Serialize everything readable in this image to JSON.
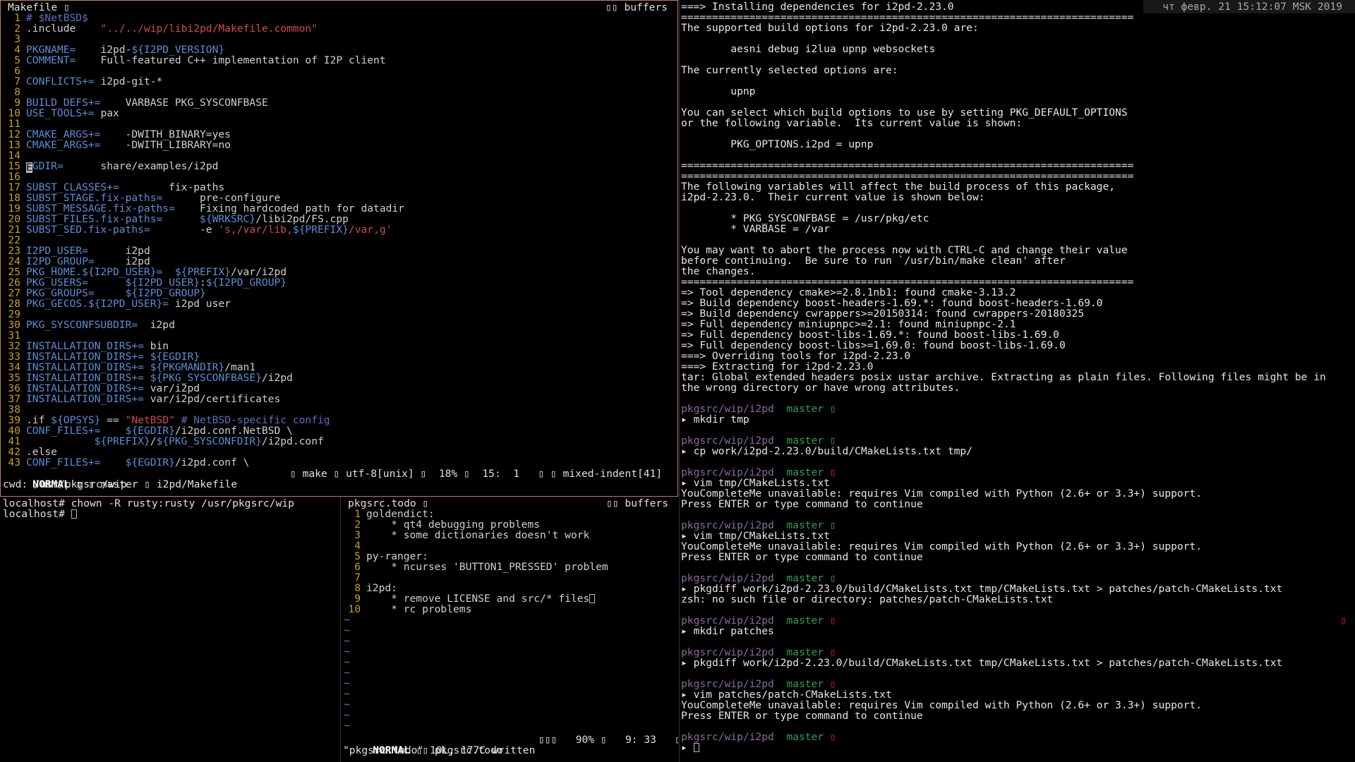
{
  "makefile": {
    "title": "Makefile ▯",
    "buffers_label": "▯▯ buffers",
    "lines": [
      {
        "n": "1",
        "parts": [
          [
            "c",
            "# $NetBSD$"
          ]
        ]
      },
      {
        "n": "2",
        "parts": [
          [
            "plain",
            ".include    "
          ],
          [
            "s",
            "\"../../wip/libi2pd/Makefile.common\""
          ]
        ]
      },
      {
        "n": "3",
        "parts": []
      },
      {
        "n": "4",
        "parts": [
          [
            "v",
            "PKGNAME="
          ],
          [
            "plain",
            "    i2pd-"
          ],
          [
            "v",
            "${I2PD_VERSION}"
          ]
        ]
      },
      {
        "n": "5",
        "parts": [
          [
            "v",
            "COMMENT="
          ],
          [
            "plain",
            "    Full-featured C++ implementation of I2P client"
          ]
        ]
      },
      {
        "n": "6",
        "parts": []
      },
      {
        "n": "7",
        "parts": [
          [
            "v",
            "CONFLICTS+="
          ],
          [
            "plain",
            " i2pd-git-*"
          ]
        ]
      },
      {
        "n": "8",
        "parts": []
      },
      {
        "n": "9",
        "parts": [
          [
            "v",
            "BUILD_DEFS+="
          ],
          [
            "plain",
            "    VARBASE PKG_SYSCONFBASE"
          ]
        ]
      },
      {
        "n": "10",
        "parts": [
          [
            "v",
            "USE_TOOLS+="
          ],
          [
            "plain",
            " pax"
          ]
        ]
      },
      {
        "n": "11",
        "parts": []
      },
      {
        "n": "12",
        "parts": [
          [
            "v",
            "CMAKE_ARGS+="
          ],
          [
            "plain",
            "    -DWITH_BINARY=yes"
          ]
        ]
      },
      {
        "n": "13",
        "parts": [
          [
            "v",
            "CMAKE_ARGS+="
          ],
          [
            "plain",
            "    -DWITH_LIBRARY=no"
          ]
        ]
      },
      {
        "n": "14",
        "parts": []
      },
      {
        "n": "15",
        "parts": [
          [
            "cursor",
            "E"
          ],
          [
            "v",
            "GDIR="
          ],
          [
            "plain",
            "      share/examples/i2pd"
          ]
        ]
      },
      {
        "n": "16",
        "parts": []
      },
      {
        "n": "17",
        "parts": [
          [
            "v",
            "SUBST_CLASSES+="
          ],
          [
            "plain",
            "        fix-paths"
          ]
        ]
      },
      {
        "n": "18",
        "parts": [
          [
            "v",
            "SUBST_STAGE.fix-paths="
          ],
          [
            "plain",
            "      pre-configure"
          ]
        ]
      },
      {
        "n": "19",
        "parts": [
          [
            "v",
            "SUBST_MESSAGE.fix-paths="
          ],
          [
            "plain",
            "    Fixing hardcoded path for datadir"
          ]
        ]
      },
      {
        "n": "20",
        "parts": [
          [
            "v",
            "SUBST_FILES.fix-paths="
          ],
          [
            "plain",
            "      "
          ],
          [
            "v",
            "${WRKSRC}"
          ],
          [
            "plain",
            "/libi2pd/FS.cpp"
          ]
        ]
      },
      {
        "n": "21",
        "parts": [
          [
            "v",
            "SUBST_SED.fix-paths="
          ],
          [
            "plain",
            "        -e "
          ],
          [
            "s",
            "'s,/var/lib,"
          ],
          [
            "v",
            "${PREFIX}"
          ],
          [
            "s",
            "/var,g'"
          ]
        ]
      },
      {
        "n": "22",
        "parts": []
      },
      {
        "n": "23",
        "parts": [
          [
            "v",
            "I2PD_USER="
          ],
          [
            "plain",
            "      i2pd"
          ]
        ]
      },
      {
        "n": "24",
        "parts": [
          [
            "v",
            "I2PD_GROUP="
          ],
          [
            "plain",
            "     i2pd"
          ]
        ]
      },
      {
        "n": "25",
        "parts": [
          [
            "v",
            "PKG_HOME.${I2PD_USER}="
          ],
          [
            "plain",
            "  "
          ],
          [
            "v",
            "${PREFIX}"
          ],
          [
            "plain",
            "/var/i2pd"
          ]
        ]
      },
      {
        "n": "26",
        "parts": [
          [
            "v",
            "PKG_USERS="
          ],
          [
            "plain",
            "      "
          ],
          [
            "v",
            "${I2PD_USER}"
          ],
          [
            "plain",
            ":"
          ],
          [
            "v",
            "${I2PD_GROUP}"
          ]
        ]
      },
      {
        "n": "27",
        "parts": [
          [
            "v",
            "PKG_GROUPS="
          ],
          [
            "plain",
            "     "
          ],
          [
            "v",
            "${I2PD_GROUP}"
          ]
        ]
      },
      {
        "n": "28",
        "parts": [
          [
            "v",
            "PKG_GECOS.${I2PD_USER}="
          ],
          [
            "plain",
            " i2pd user"
          ]
        ]
      },
      {
        "n": "29",
        "parts": []
      },
      {
        "n": "30",
        "parts": [
          [
            "v",
            "PKG_SYSCONFSUBDIR="
          ],
          [
            "plain",
            "  i2pd"
          ]
        ]
      },
      {
        "n": "31",
        "parts": []
      },
      {
        "n": "32",
        "parts": [
          [
            "v",
            "INSTALLATION_DIRS+="
          ],
          [
            "plain",
            " bin"
          ]
        ]
      },
      {
        "n": "33",
        "parts": [
          [
            "v",
            "INSTALLATION_DIRS+="
          ],
          [
            "plain",
            " "
          ],
          [
            "v",
            "${EGDIR}"
          ]
        ]
      },
      {
        "n": "34",
        "parts": [
          [
            "v",
            "INSTALLATION_DIRS+="
          ],
          [
            "plain",
            " "
          ],
          [
            "v",
            "${PKGMANDIR}"
          ],
          [
            "plain",
            "/man1"
          ]
        ]
      },
      {
        "n": "35",
        "parts": [
          [
            "v",
            "INSTALLATION_DIRS+="
          ],
          [
            "plain",
            " "
          ],
          [
            "v",
            "${PKG_SYSCONFBASE}"
          ],
          [
            "plain",
            "/i2pd"
          ]
        ]
      },
      {
        "n": "36",
        "parts": [
          [
            "v",
            "INSTALLATION_DIRS+="
          ],
          [
            "plain",
            " var/i2pd"
          ]
        ]
      },
      {
        "n": "37",
        "parts": [
          [
            "v",
            "INSTALLATION_DIRS+="
          ],
          [
            "plain",
            " var/i2pd/certificates"
          ]
        ]
      },
      {
        "n": "38",
        "parts": []
      },
      {
        "n": "39",
        "parts": [
          [
            "plain",
            ".if "
          ],
          [
            "v",
            "${OPSYS}"
          ],
          [
            "plain",
            " == "
          ],
          [
            "s",
            "\"NetBSD\""
          ],
          [
            "plain",
            " "
          ],
          [
            "c",
            "# NetBSD-specific config"
          ]
        ]
      },
      {
        "n": "40",
        "parts": [
          [
            "v",
            "CONF_FILES+="
          ],
          [
            "plain",
            "    "
          ],
          [
            "v",
            "${EGDIR}"
          ],
          [
            "plain",
            "/i2pd.conf.NetBSD \\"
          ]
        ]
      },
      {
        "n": "41",
        "parts": [
          [
            "plain",
            "           "
          ],
          [
            "v",
            "${PREFIX}"
          ],
          [
            "plain",
            "/"
          ],
          [
            "v",
            "${PKG_SYSCONFDIR}"
          ],
          [
            "plain",
            "/i2pd.conf"
          ]
        ]
      },
      {
        "n": "42",
        "parts": [
          [
            "plain",
            ".else"
          ]
        ]
      },
      {
        "n": "43",
        "parts": [
          [
            "v",
            "CONF_FILES+="
          ],
          [
            "plain",
            "    "
          ],
          [
            "v",
            "${EGDIR}"
          ],
          [
            "plain",
            "/i2pd.conf \\"
          ]
        ]
      }
    ],
    "status_mode": "NORMAL",
    "status_left": " ▯ ▯ master ▯ i2pd/Makefile",
    "status_right": "▯ make ▯ utf-8[unix] ▯  18% ▯  15:  1   ▯ ▯ mixed-indent[41]",
    "cmdline": "cwd: /usr/pkgsrc/wip"
  },
  "shell": {
    "lines": [
      "localhost# chown -R rusty:rusty /usr/pkgsrc/wip",
      "localhost# "
    ]
  },
  "todo": {
    "title": "pkgsrc.todo ▯",
    "buffers_label": "▯▯ buffers",
    "lines": [
      {
        "n": "1",
        "text": "goldendict:"
      },
      {
        "n": "2",
        "text": "    * qt4 debugging problems"
      },
      {
        "n": "3",
        "text": "    * some dictionaries doesn't work"
      },
      {
        "n": "4",
        "text": ""
      },
      {
        "n": "5",
        "text": "py-ranger:"
      },
      {
        "n": "6",
        "text": "    * ncurses 'BUTTON1_PRESSED' problem"
      },
      {
        "n": "7",
        "text": ""
      },
      {
        "n": "8",
        "text": "i2pd:"
      },
      {
        "n": "9",
        "text": "    * remove LICENSE and src/* files"
      },
      {
        "n": "10",
        "text": "    * rc problems"
      }
    ],
    "tilde": "~",
    "status_mode": "NORMAL",
    "status_left": " ▯▯ pkgsrc.todo",
    "status_right": "▯▯▯   90% ▯   9: 33   ▯",
    "cmdline": "\"pkgsrc.todo\" 10L, 177C written"
  },
  "right": {
    "clock": "чт февр. 21 15:12:07 MSK 2019",
    "output": [
      "===> Installing dependencies for i2pd-2.23.0",
      "=========================================================================",
      "The supported build options for i2pd-2.23.0 are:",
      "",
      "        aesni debug i2lua upnp websockets",
      "",
      "The currently selected options are:",
      "",
      "        upnp",
      "",
      "You can select which build options to use by setting PKG_DEFAULT_OPTIONS",
      "or the following variable.  Its current value is shown:",
      "",
      "        PKG_OPTIONS.i2pd = upnp",
      "",
      "=========================================================================",
      "=========================================================================",
      "The following variables will affect the build process of this package,",
      "i2pd-2.23.0.  Their current value is shown below:",
      "",
      "        * PKG_SYSCONFBASE = /usr/pkg/etc",
      "        * VARBASE = /var",
      "",
      "You may want to abort the process now with CTRL-C and change their value",
      "before continuing.  Be sure to run `/usr/bin/make clean' after",
      "the changes.",
      "=========================================================================",
      "=> Tool dependency cmake>=2.8.1nb1: found cmake-3.13.2",
      "=> Build dependency boost-headers-1.69.*: found boost-headers-1.69.0",
      "=> Build dependency cwrappers>=20150314: found cwrappers-20180325",
      "=> Full dependency miniupnpc>=2.1: found miniupnpc-2.1",
      "=> Full dependency boost-libs-1.69.*: found boost-libs-1.69.0",
      "=> Full dependency boost-libs>=1.69.0: found boost-libs-1.69.0",
      "===> Overriding tools for i2pd-2.23.0",
      "===> Extracting for i2pd-2.23.0",
      "tar: Global extended headers posix ustar archive. Extracting as plain files. Following files might be in",
      "the wrong directory or have wrong attributes.",
      ""
    ],
    "prompt_path": "pkgsrc/wip/i2pd",
    "prompt_branch": "master",
    "prompt_glyph": "▯",
    "cmd_arrow": "▸",
    "blocks": [
      {
        "status": "ok",
        "cmd": "mkdir tmp",
        "out": []
      },
      {
        "status": "ok",
        "cmd": "cp work/i2pd-2.23.0/build/CMakeLists.txt tmp/",
        "out": []
      },
      {
        "status": "err",
        "cmd": "vim tmp/CMakeLists.txt",
        "out": [
          "YouCompleteMe unavailable: requires Vim compiled with Python (2.6+ or 3.3+) support.",
          "Press ENTER or type command to continue"
        ]
      },
      {
        "status": "ok",
        "cmd": "vim tmp/CMakeLists.txt",
        "out": [
          "YouCompleteMe unavailable: requires Vim compiled with Python (2.6+ or 3.3+) support.",
          "Press ENTER or type command to continue"
        ]
      },
      {
        "status": "ok",
        "cmd": "pkgdiff work/i2pd-2.23.0/build/CMakeLists.txt tmp/CMakeLists.txt > patches/patch-CMakeLists.txt",
        "out": [
          "zsh: no such file or directory: patches/patch-CMakeLists.txt"
        ]
      },
      {
        "status": "err",
        "cmd": "mkdir patches",
        "out": [],
        "right_mark": true
      },
      {
        "status": "err",
        "cmd": "pkgdiff work/i2pd-2.23.0/build/CMakeLists.txt tmp/CMakeLists.txt > patches/patch-CMakeLists.txt",
        "out": []
      },
      {
        "status": "err",
        "cmd": "vim patches/patch-CMakeLists.txt",
        "out": [
          "YouCompleteMe unavailable: requires Vim compiled with Python (2.6+ or 3.3+) support.",
          "Press ENTER or type command to continue"
        ]
      },
      {
        "status": "err",
        "cmd": "",
        "out": [],
        "cursor": true
      }
    ]
  }
}
